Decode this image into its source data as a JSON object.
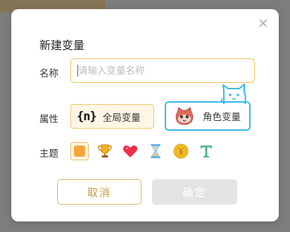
{
  "dialog": {
    "title": "新建变量",
    "close_icon": "close-icon"
  },
  "form": {
    "name": {
      "label": "名称",
      "value": "",
      "placeholder": "请输入变量名称"
    },
    "attribute": {
      "label": "属性",
      "options": [
        {
          "glyph": "{n}",
          "label": "全局变量",
          "selected": true
        },
        {
          "icon": "cat-avatar-icon",
          "label": "角色变量",
          "selected": false
        }
      ]
    },
    "theme": {
      "label": "主题",
      "options": [
        {
          "icon": "orange-square-icon",
          "selected": true
        },
        {
          "icon": "trophy-icon",
          "selected": false
        },
        {
          "icon": "heart-icon",
          "selected": false
        },
        {
          "icon": "hourglass-icon",
          "selected": false
        },
        {
          "icon": "coin-icon",
          "selected": false
        },
        {
          "icon": "text-t-icon",
          "selected": false
        }
      ]
    }
  },
  "buttons": {
    "cancel": "取消",
    "confirm": "确定"
  },
  "colors": {
    "accent": "#f3c452",
    "highlight": "#33b6e4",
    "cancel_text": "#c79a3a",
    "confirm_disabled_bg": "#e4e4e4"
  }
}
